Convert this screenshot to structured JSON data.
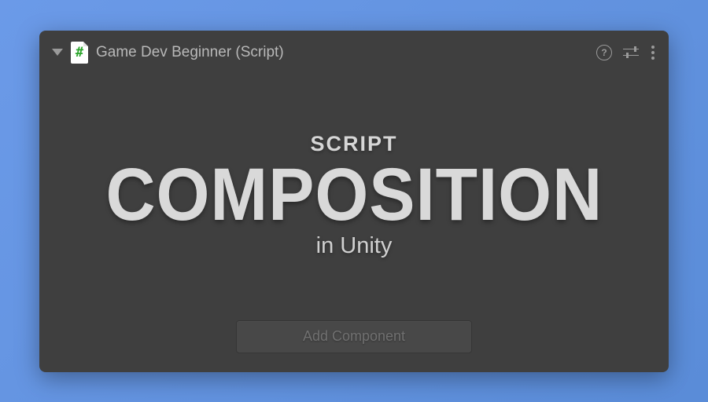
{
  "header": {
    "component_title": "Game Dev Beginner (Script)",
    "help_glyph": "?"
  },
  "main": {
    "title_top": "SCRIPT",
    "title_main": "COMPOSITION",
    "title_bottom": "in Unity"
  },
  "footer": {
    "add_component_label": "Add Component"
  }
}
